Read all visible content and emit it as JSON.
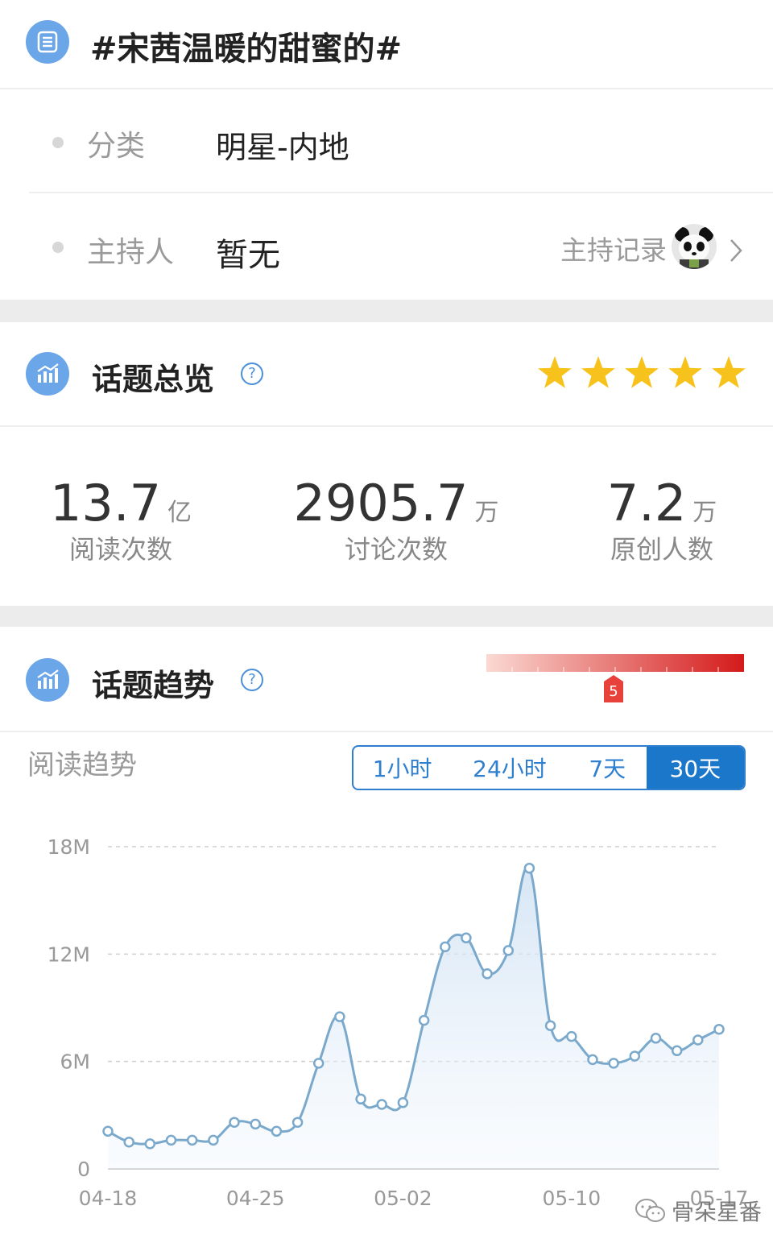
{
  "header": {
    "title": "#宋茜温暖的甜蜜的#",
    "icon": "list-icon"
  },
  "info": {
    "category_label": "分类",
    "category_value": "明星-内地",
    "host_label": "主持人",
    "host_value": "暂无",
    "host_record_label": "主持记录"
  },
  "overview": {
    "title": "话题总览",
    "rating_stars": 5,
    "star_color": "#f7c21c",
    "stats": [
      {
        "value": "13.7",
        "unit": "亿",
        "label": "阅读次数"
      },
      {
        "value": "2905.7",
        "unit": "万",
        "label": "讨论次数"
      },
      {
        "value": "7.2",
        "unit": "万",
        "label": "原创人数"
      }
    ]
  },
  "trend": {
    "title": "话题趋势",
    "heat_level": "5",
    "heat_color": "#e8302a",
    "subtitle": "阅读趋势",
    "tabs": [
      "1小时",
      "24小时",
      "7天",
      "30天"
    ],
    "active_tab": "30天"
  },
  "watermark": "骨朵星番",
  "chart_data": {
    "type": "line",
    "y_ticks": [
      "0",
      "6M",
      "12M",
      "18M"
    ],
    "ylim": [
      0,
      18
    ],
    "x_tick_labels": [
      {
        "label": "04-18",
        "index": 0
      },
      {
        "label": "04-25",
        "index": 7
      },
      {
        "label": "05-02",
        "index": 14
      },
      {
        "label": "05-10",
        "index": 22
      },
      {
        "label": "05-17",
        "index": 29
      }
    ],
    "grid": "dashed-horizontal",
    "series": [
      {
        "color": "#7aa9cc",
        "values": [
          2.1,
          1.5,
          1.4,
          1.6,
          1.6,
          1.6,
          2.6,
          2.5,
          2.1,
          2.6,
          5.9,
          8.5,
          3.9,
          3.6,
          3.7,
          8.3,
          12.4,
          12.9,
          10.9,
          12.2,
          16.8,
          8.0,
          7.4,
          6.1,
          5.9,
          6.3,
          7.3,
          6.6,
          7.2,
          7.8
        ]
      }
    ]
  }
}
